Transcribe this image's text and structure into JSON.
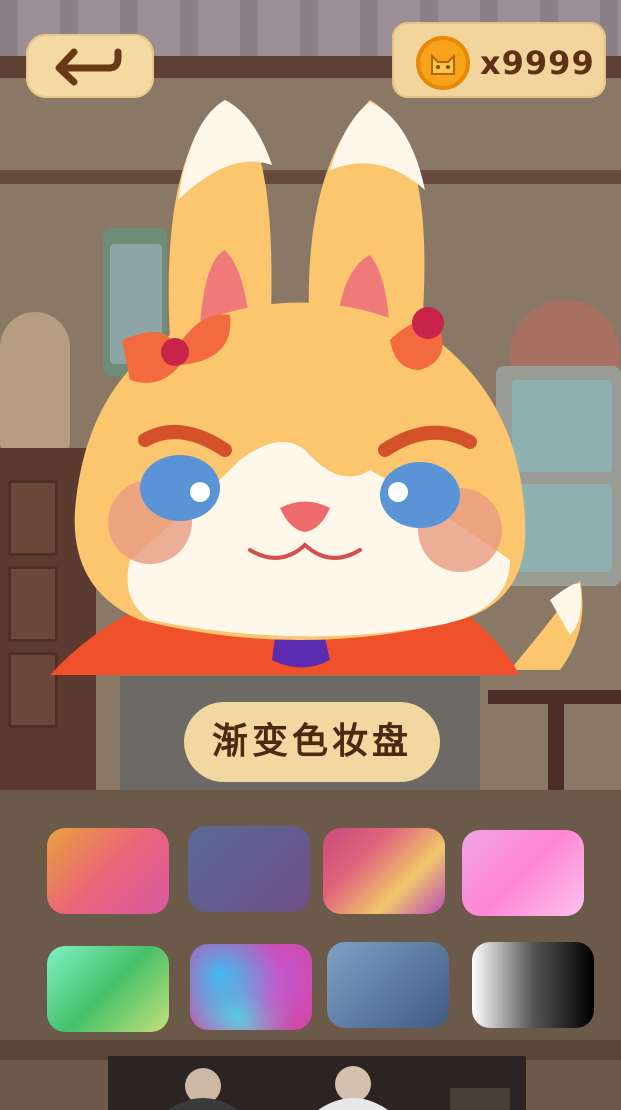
{
  "header": {
    "back_icon": "back-arrow-icon",
    "coin_icon": "cat-coin-icon",
    "coin_count": "x9999"
  },
  "palette": {
    "title": "渐变色妆盘",
    "swatches": [
      {
        "id": "orange-pink",
        "colors": [
          "#e8a23c",
          "#e9657a",
          "#d85aa0"
        ]
      },
      {
        "id": "slate-purple",
        "colors": [
          "#5a6a98",
          "#6e4e86"
        ]
      },
      {
        "id": "pink-gold-purple",
        "colors": [
          "#c84a7e",
          "#e0647b",
          "#f2c76b",
          "#b94ab8"
        ]
      },
      {
        "id": "light-pink",
        "colors": [
          "#f0a6e6",
          "#ff86d2",
          "#ffc2f0"
        ]
      },
      {
        "id": "mint-green",
        "colors": [
          "#7ff2c6",
          "#45c06a",
          "#c5e07a"
        ]
      },
      {
        "id": "holographic",
        "colors": [
          "#44b8f0",
          "#c458d0",
          "#5ad8e0",
          "#d048a8"
        ]
      },
      {
        "id": "steel-blue",
        "colors": [
          "#7ea1c6",
          "#405a80"
        ]
      },
      {
        "id": "white-black",
        "colors": [
          "#ffffff",
          "#555555",
          "#000000"
        ]
      }
    ]
  },
  "character": {
    "name_icon": "rabbit-character"
  }
}
